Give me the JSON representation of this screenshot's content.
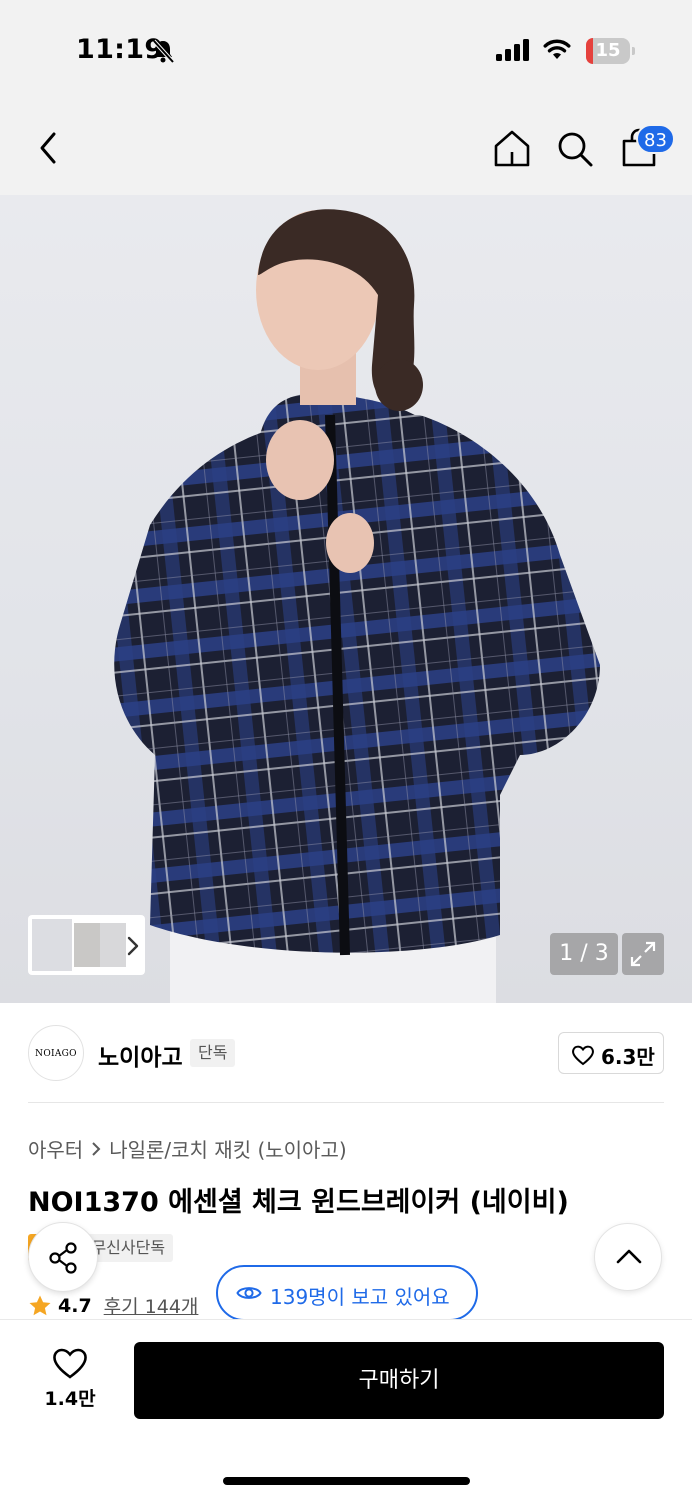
{
  "status_bar": {
    "time": "11:19",
    "battery_level": "15",
    "battery_color": "#e5413d"
  },
  "nav": {
    "cart_count": "83"
  },
  "gallery": {
    "pager": "1 / 3"
  },
  "brand": {
    "logo_text": "NOIAGO",
    "name": "노이아고",
    "tag": "단독",
    "likes": "6.3만"
  },
  "product": {
    "breadcrumb": [
      "아우터",
      "나일론/코치 재킷 (노이아고)"
    ],
    "title": "NOI1370 에센셜 체크 윈드브레이커 (네이비)",
    "badges": {
      "sale": "세일",
      "exclusive": "무신사단독"
    },
    "rating": "4.7",
    "reviews": "후기 144개",
    "viewers": "139명이 보고 있어요"
  },
  "bottom_bar": {
    "wish_count": "1.4만",
    "buy_label": "구매하기"
  },
  "colors": {
    "accent_blue": "#1f6ae8",
    "sale_orange": "#f5a623",
    "star": "#f5a623"
  }
}
